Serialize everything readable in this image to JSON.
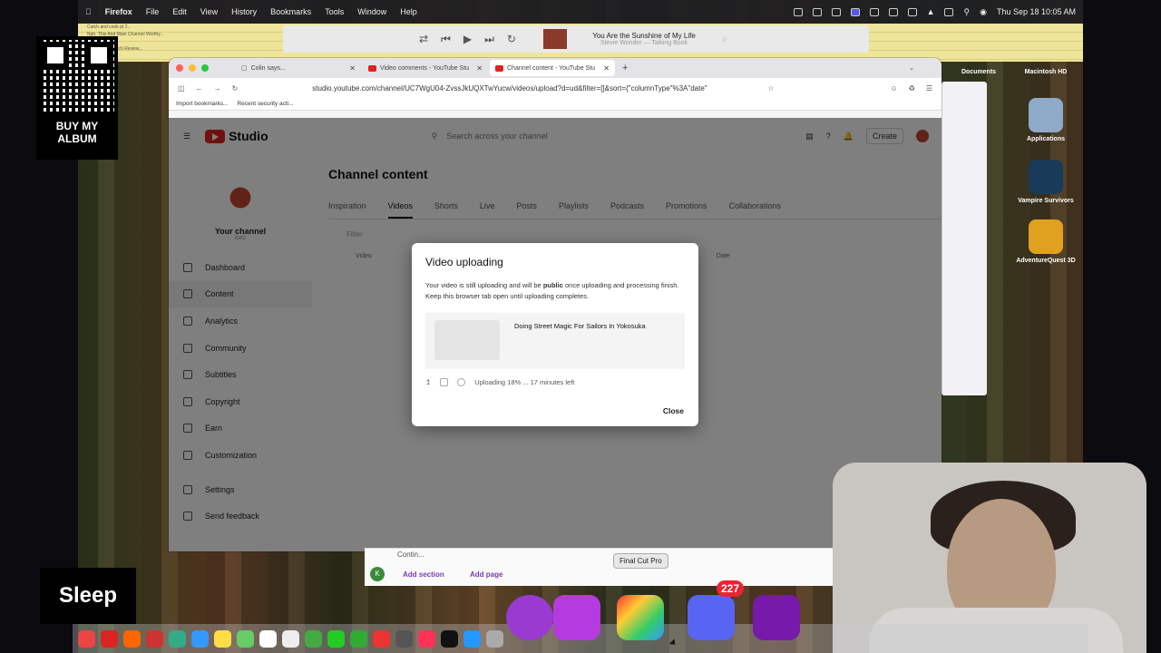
{
  "menubar": {
    "app": "Firefox",
    "items": [
      "File",
      "Edit",
      "View",
      "History",
      "Bookmarks",
      "Tools",
      "Window",
      "Help"
    ],
    "clock": "Thu Sep 18  10:05 AM"
  },
  "notes": {
    "lines": [
      "Catch and cook pt 2...",
      "Nah. This And Main Channel Worthy...",
      "",
      "konbini...",
      "Konbini Sandwich Review..."
    ]
  },
  "music": {
    "title": "You Are the Sunshine of My Life",
    "artist": "Stevie Wonder — Talking Book"
  },
  "promo": {
    "qr_label": "BUY MY ALBUM"
  },
  "browser": {
    "tabs": [
      {
        "label": "Colin says..."
      },
      {
        "label": "Video comments - YouTube Stu"
      },
      {
        "label": "Channel content - YouTube Stu"
      }
    ],
    "url": "studio.youtube.com/channel/UC7WgU04-ZvssJkUQXTwYucw/videos/upload?d=ud&filter=[]&sort={\"columnType\"%3A\"date\"",
    "bookmarks": [
      "Import bookmarks...",
      "Recent security acti..."
    ]
  },
  "studio": {
    "logo": "Studio",
    "search_placeholder": "Search across your channel",
    "create_label": "Create",
    "channel_name": "Your channel",
    "channel_handle": "Kel2",
    "nav": [
      "Dashboard",
      "Content",
      "Analytics",
      "Community",
      "Subtitles",
      "Copyright",
      "Earn",
      "Customization",
      "Settings",
      "Send feedback"
    ],
    "page_title": "Channel content",
    "tabs": [
      "Inspiration",
      "Videos",
      "Shorts",
      "Live",
      "Posts",
      "Playlists",
      "Podcasts",
      "Promotions",
      "Collaborations"
    ],
    "filter": "Filter",
    "col_video": "Video",
    "col_date": "Date",
    "col_views": "Views",
    "col_comments": "Comments",
    "col_likes": "Likes (vs. dislike"
  },
  "modal": {
    "title": "Video uploading",
    "desc_pre": "Your video is still uploading and will be ",
    "desc_bold": "public",
    "desc_post": " once uploading and processing finish. Keep this browser tab open until uploading completes.",
    "video_title": "Doing Street Magic For Sailors In Yokosuka",
    "status": "Uploading 18% ... 17 minutes left",
    "progress": 0.18,
    "close_label": "Close"
  },
  "desktop": {
    "icons": [
      "Documents",
      "Macintosh HD",
      "Applications",
      "Vampire Survivors",
      "AdventureQuest 3D"
    ]
  },
  "overlay": {
    "sleep_label": "Sleep"
  },
  "onenote": {
    "section": "Contin...",
    "add_section": "Add section",
    "add_page": "Add page",
    "avatar_letter": "K"
  },
  "dock": {
    "tooltip": "Final Cut Pro",
    "badge": "227"
  }
}
